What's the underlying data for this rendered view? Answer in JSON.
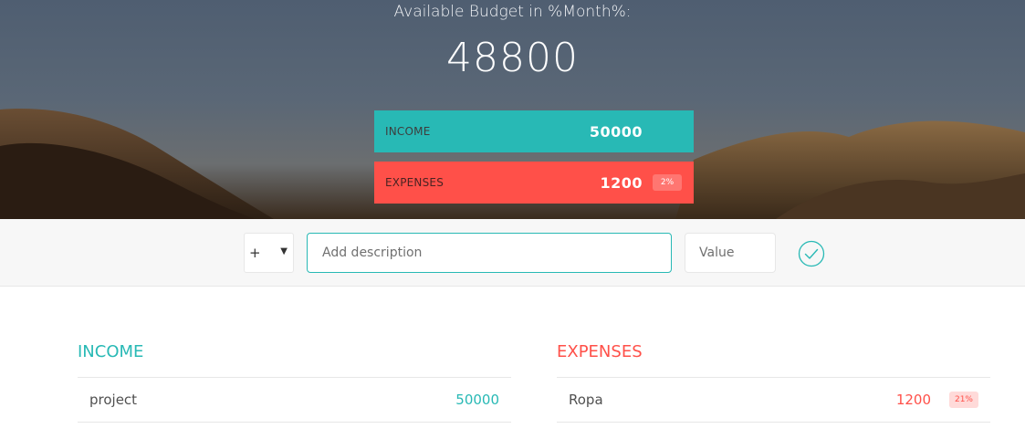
{
  "header": {
    "title": "Available Budget in %Month%:",
    "budget": "48800",
    "income_label": "INCOME",
    "income_value": "50000",
    "expenses_label": "EXPENSES",
    "expenses_value": "1200",
    "expenses_percentage": "2%"
  },
  "add_bar": {
    "type_value": "+",
    "type_options": [
      "+"
    ],
    "description_placeholder": "Add description",
    "value_placeholder": "Value",
    "submit_icon": "checkmark-circle-icon"
  },
  "income": {
    "title": "Income",
    "items": [
      {
        "description": "project",
        "value": "50000"
      }
    ]
  },
  "expenses": {
    "title": "Expenses",
    "items": [
      {
        "description": "Ropa",
        "value": "1200",
        "percentage": "21%"
      }
    ]
  },
  "colors": {
    "income": "#28b9b5",
    "expenses": "#ff5049",
    "bar_background": "#f7f7f7"
  }
}
